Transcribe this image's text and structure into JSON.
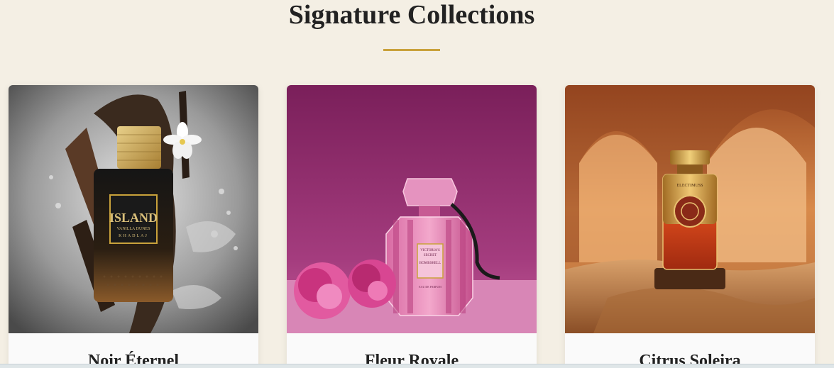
{
  "section": {
    "title": "Signature Collections",
    "accent_color": "#c9a23b"
  },
  "products": [
    {
      "name": "Noir Éternel",
      "image_icon": "dark-perfume-bottle-with-vanilla-icon",
      "bottle_label": {
        "brand": "ISLAND",
        "line1": "VANILLA DUNES",
        "line2": "KHADLAJ"
      }
    },
    {
      "name": "Fleur Royale",
      "image_icon": "pink-perfume-bottle-with-peonies-icon",
      "bottle_label": {
        "line1": "VICTORIA'S",
        "line2": "SECRET",
        "line3": "BOMBSHELL",
        "line4": "EAU DE PARFUM"
      }
    },
    {
      "name": "Citrus Soleira",
      "image_icon": "amber-perfume-bottle-in-desert-arches-icon",
      "bottle_label": {
        "brand": "ELECTIMUSS"
      }
    }
  ]
}
